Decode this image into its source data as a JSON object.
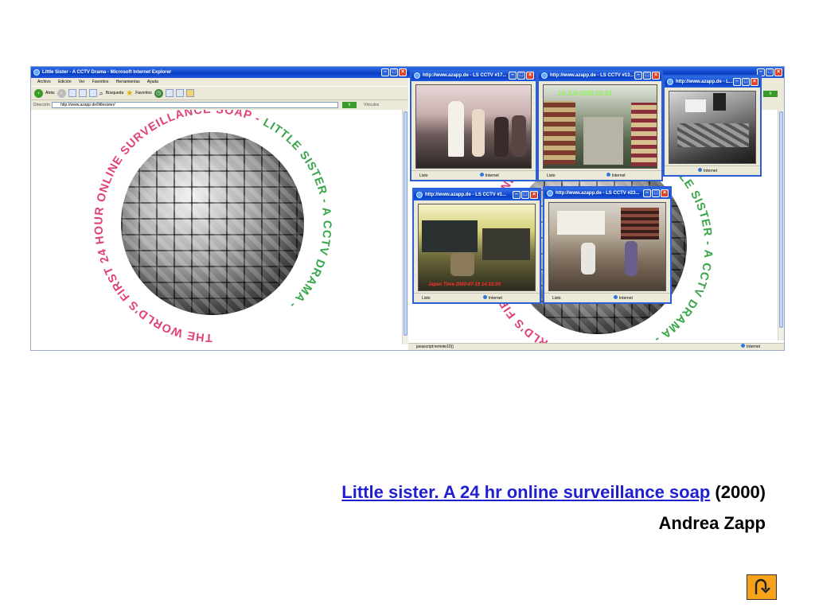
{
  "ie_window": {
    "title": "Little Sister - A CCTV Drama - Microsoft Internet Explorer",
    "menu": [
      "Archivo",
      "Edición",
      "Ver",
      "Favoritos",
      "Herramientas",
      "Ayuda"
    ],
    "toolbar": {
      "back": "Atrás",
      "search": "Búsqueda",
      "favorites": "Favoritos"
    },
    "address_label": "Dirección",
    "address_value": "http://www.azapp.de/littlesister/",
    "go_label": "Ir",
    "links_label": "Vínculos",
    "status_text": "javascript:remote10()",
    "status_zone": "Internet"
  },
  "sphere": {
    "ring_text": "THE WORLD'S FIRST 24 HOUR ONLINE SURVEILLANCE SOAP - ",
    "ring_text_green": "LITTLE SISTER - A CCTV DRAMA - ",
    "ring_color_pink": "#e0407a",
    "ring_color_green": "#3aa64a"
  },
  "popups": [
    {
      "title": "http://www.azapp.de - LS CCTV #17...",
      "status": "Listo",
      "zone": "Internet"
    },
    {
      "title": "http://www.azapp.de - LS CCTV #13...",
      "status": "Listo",
      "zone": "Internet",
      "overlay": "10 Juli 2000 10:24"
    },
    {
      "title": "http://www.azapp.de - L...",
      "zone": "Internet"
    },
    {
      "title": "http://www.azapp.de - LS CCTV #1...",
      "status": "Listo",
      "zone": "Internet",
      "timestamp": "Japan Time 2000-07-19 14:10:00"
    },
    {
      "title": "http://www.azapp.de - LS CCTV #23...",
      "status": "Listo",
      "zone": "Internet"
    }
  ],
  "right_ie": {
    "go_label": "Ir",
    "status_text": "javascript:remote10()",
    "status_zone": "Internet"
  },
  "caption": {
    "link_text": "Little sister. A 24 hr online surveillance soap",
    "year": "(2000)",
    "author": "Andrea Zapp"
  },
  "colors": {
    "accent_orange": "#f7a21a",
    "link_blue": "#1f1fd0",
    "xp_blue": "#0a3fc4"
  },
  "icons": {
    "return": "return-arrow-icon"
  }
}
